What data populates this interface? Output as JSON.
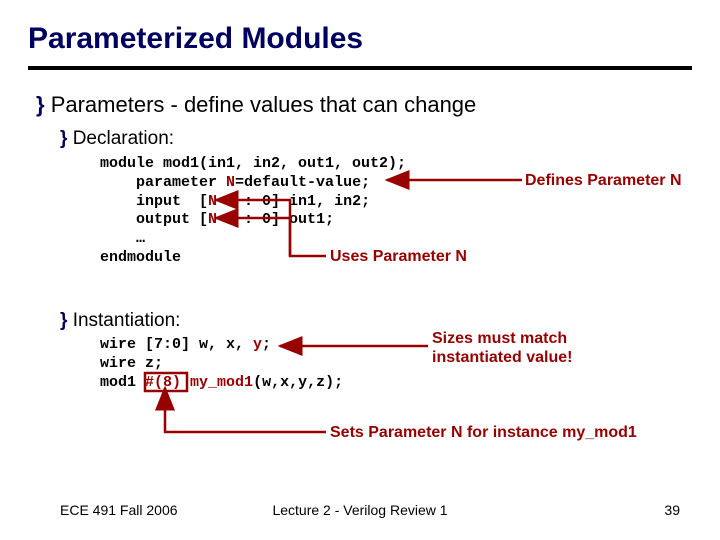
{
  "title": "Parameterized Modules",
  "bullet_main": "Parameters - define values that can change",
  "bullet_sub1": "Declaration:",
  "bullet_sub2": "Instantiation:",
  "bullet_symbol": "}",
  "code1": {
    "l1a": "module mod1(in1, in2, out1, out2);",
    "l2a": "    parameter ",
    "l2b": "N",
    "l2c": "=default-value;",
    "l3a": "    input  [",
    "l3b": "N",
    "l3c": "-1 : 0] in1, in2;",
    "l4a": "    output [",
    "l4b": "N",
    "l4c": "-1 : 0] out1;",
    "l5a": "    …",
    "l6a": "endmodule"
  },
  "code2": {
    "l1a": "wire [7:0] w, x, ",
    "l1b": "y",
    "l1c": ";",
    "l2a": "wire z;",
    "l3a": "mod1 ",
    "l3b": "#(8)",
    "l3c": " ",
    "l3d": "my_mod1",
    "l3e": "(w,x,y,z);"
  },
  "ann1": "Defines Parameter N",
  "ann2": "Uses Parameter N",
  "ann3_a": "Sizes must match",
  "ann3_b": "instantiated value!",
  "ann4": "Sets Parameter N for instance my_mod1",
  "footer_left": "ECE 491 Fall 2006",
  "footer_center": "Lecture 2 - Verilog Review 1",
  "footer_right": "39"
}
